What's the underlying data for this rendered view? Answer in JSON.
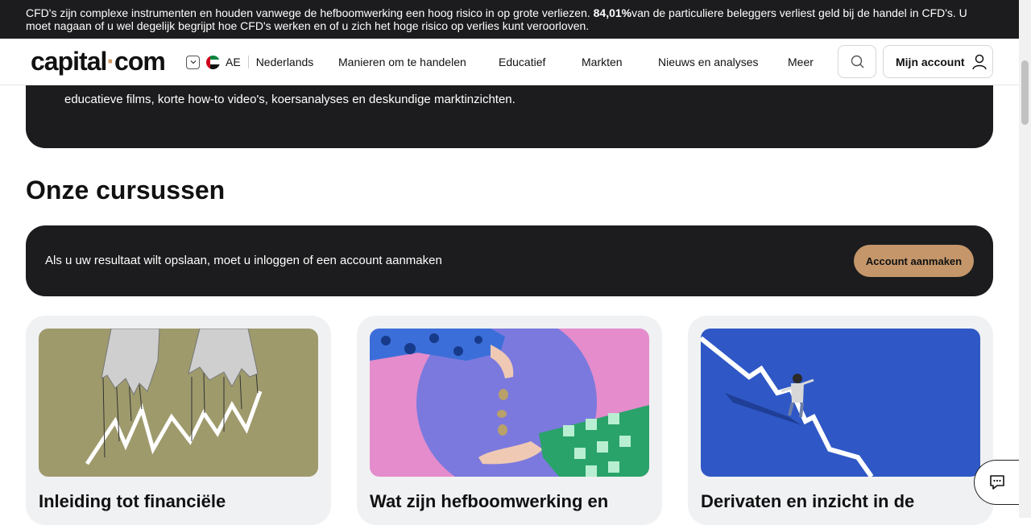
{
  "risk_banner": {
    "text_before": "CFD's zijn complexe instrumenten en houden vanwege de hefboomwerking een hoog risico in op grote verliezen. ",
    "percentage": "84,01%",
    "text_after": "van de particuliere beleggers verliest geld bij de handel in CFD's. U moet nagaan of u wel degelijk begrijpt hoe CFD's werken en of u zich het hoge risico op verlies kunt veroorloven."
  },
  "header": {
    "logo_text_a": "capital",
    "logo_dot": "·",
    "logo_text_b": "com",
    "region_code": "AE",
    "language": "Nederlands",
    "nav": [
      "Manieren om te handelen",
      "Educatief",
      "Markten",
      "Nieuws en analyses",
      "Meer"
    ],
    "account_label": "Mijn account"
  },
  "intro": {
    "text": "educatieve films, korte how-to video's, koersanalyses en deskundige marktinzichten."
  },
  "section": {
    "title": "Onze cursussen"
  },
  "login_prompt": {
    "text": "Als u uw resultaat wilt opslaan, moet u inloggen of een account aanmaken",
    "button": "Account aanmaken"
  },
  "courses": [
    {
      "title": "Inleiding tot financiële"
    },
    {
      "title": "Wat zijn hefboomwerking en"
    },
    {
      "title": "Derivaten en inzicht in de"
    }
  ],
  "colors": {
    "dark": "#1c1c1e",
    "accent": "#c4966a",
    "card_bg": "#f0f1f3"
  }
}
